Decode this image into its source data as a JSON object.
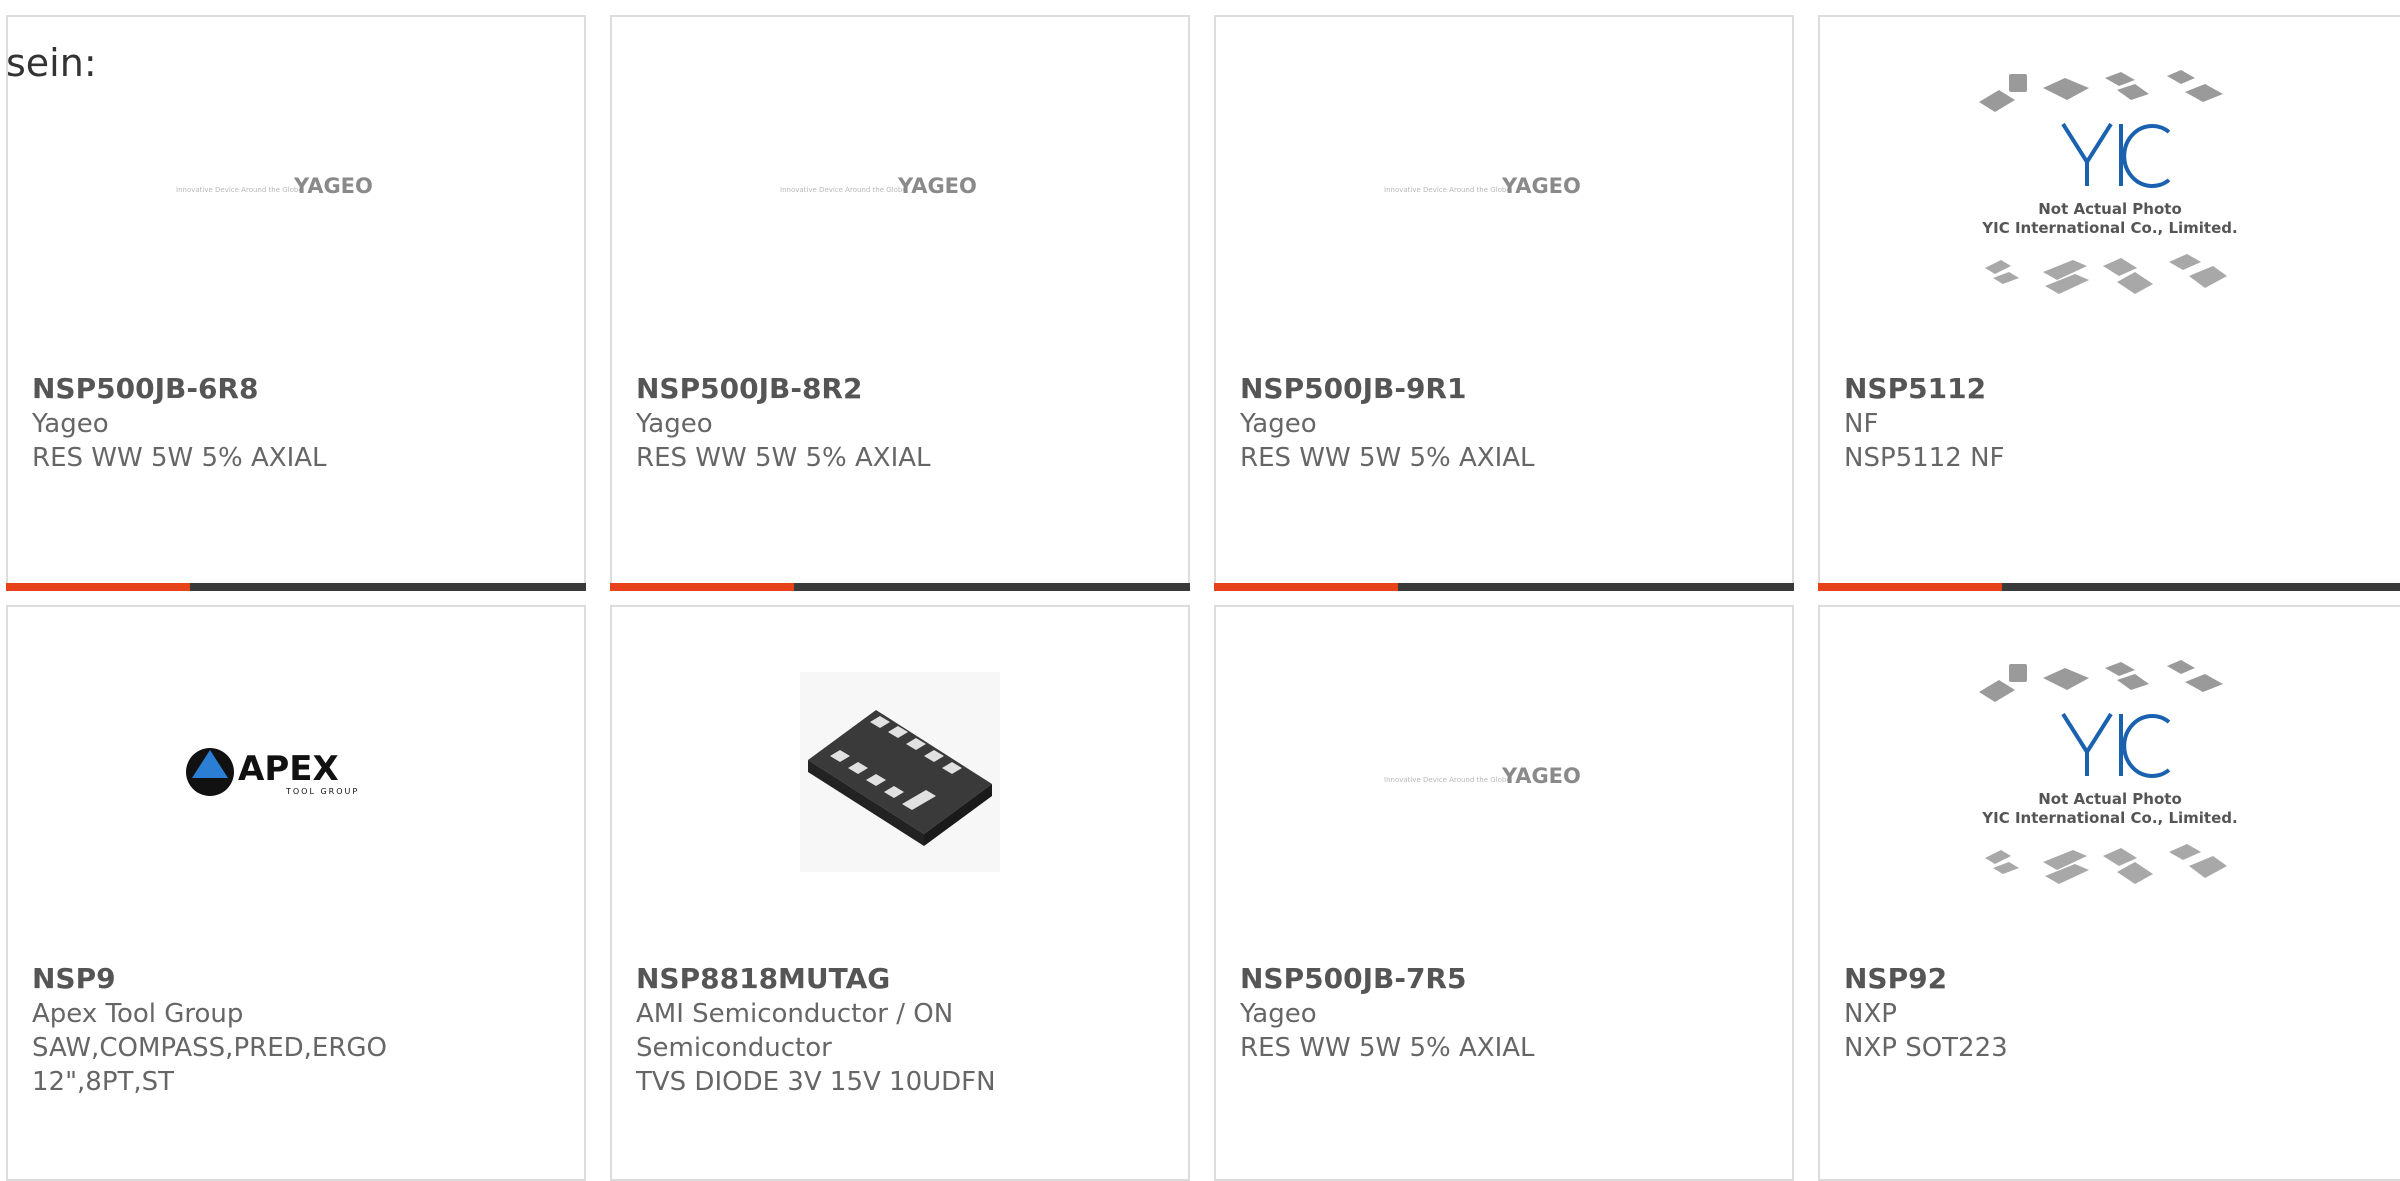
{
  "page": {
    "lead_text": "sein:"
  },
  "logos": {
    "yageo_tagline": "Innovative Device Around the Globe",
    "yageo_brand": "YAGEO",
    "apex_brand": "APEX",
    "apex_sub": "TOOL GROUP",
    "yic_brand": "YIC",
    "yic_line1": "Not Actual Photo",
    "yic_line2": "YIC International Co., Limited."
  },
  "products": [
    {
      "part": "NSP500JB-6R8",
      "manufacturer": "Yageo",
      "description": "RES WW 5W 5% AXIAL",
      "image": "yageo-logo"
    },
    {
      "part": "NSP500JB-8R2",
      "manufacturer": "Yageo",
      "description": "RES WW 5W 5% AXIAL",
      "image": "yageo-logo"
    },
    {
      "part": "NSP500JB-9R1",
      "manufacturer": "Yageo",
      "description": "RES WW 5W 5% AXIAL",
      "image": "yageo-logo"
    },
    {
      "part": "NSP5112",
      "manufacturer": "NF",
      "description": "NSP5112 NF",
      "image": "yic-placeholder"
    },
    {
      "part": "NSP9",
      "manufacturer": "Apex Tool Group",
      "description": "SAW,COMPASS,PRED,ERGO 12\",8PT,ST",
      "image": "apex-logo"
    },
    {
      "part": "NSP8818MUTAG",
      "manufacturer": "AMI Semiconductor / ON Semiconductor",
      "description": "TVS DIODE 3V 15V 10UDFN",
      "image": "udfn-chip-photo"
    },
    {
      "part": "NSP500JB-7R5",
      "manufacturer": "Yageo",
      "description": "RES WW 5W 5% AXIAL",
      "image": "yageo-logo"
    },
    {
      "part": "NSP92",
      "manufacturer": "NXP",
      "description": "NXP SOT223",
      "image": "yic-placeholder"
    }
  ],
  "colors": {
    "accent": "#e8421a",
    "bar_dark": "#3a3a3a",
    "border": "#dcdcdc",
    "text": "#666666"
  }
}
